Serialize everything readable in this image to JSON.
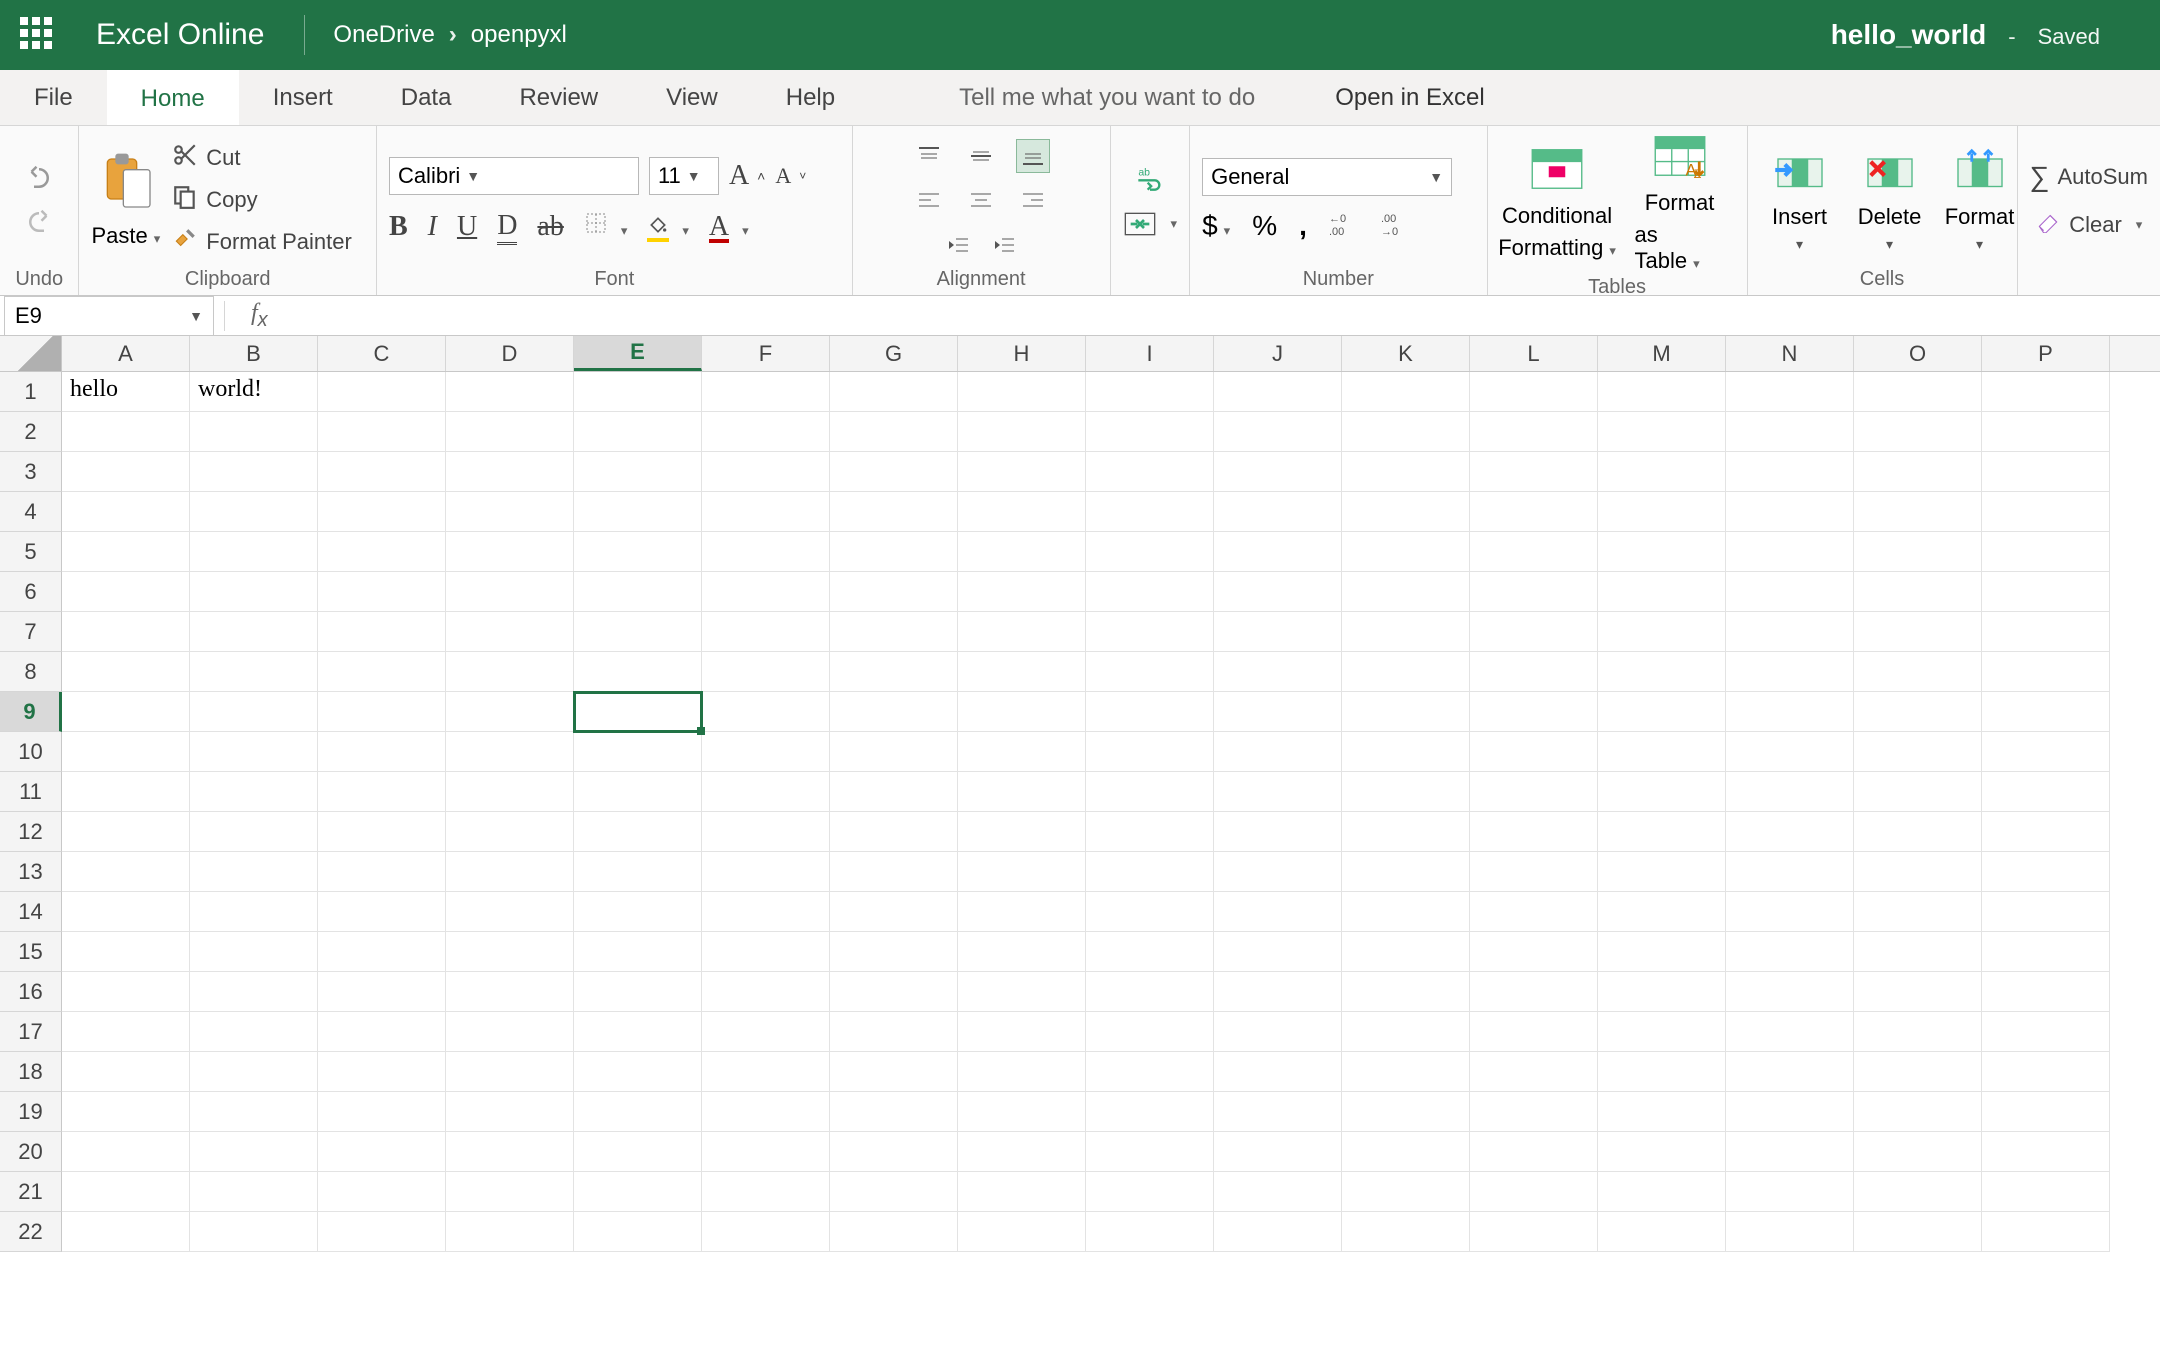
{
  "header": {
    "app_name": "Excel Online",
    "breadcrumb": [
      "OneDrive",
      "openpyxl"
    ],
    "doc_title": "hello_world",
    "status": "Saved"
  },
  "tabs": {
    "items": [
      "File",
      "Home",
      "Insert",
      "Data",
      "Review",
      "View",
      "Help"
    ],
    "active": "Home",
    "tell_me": "Tell me what you want to do",
    "open_in_excel": "Open in Excel"
  },
  "ribbon": {
    "undo_group_label": "Undo",
    "clipboard": {
      "paste": "Paste",
      "cut": "Cut",
      "copy": "Copy",
      "format_painter": "Format Painter",
      "label": "Clipboard"
    },
    "font": {
      "name": "Calibri",
      "size": "11",
      "grow": "A",
      "shrink": "A",
      "label": "Font"
    },
    "alignment": {
      "label": "Alignment"
    },
    "number": {
      "format": "General",
      "label": "Number"
    },
    "tables": {
      "conditional_formatting_l1": "Conditional",
      "conditional_formatting_l2": "Formatting",
      "format_as_table_l1": "Format",
      "format_as_table_l2": "as Table",
      "label": "Tables"
    },
    "cells": {
      "insert": "Insert",
      "delete": "Delete",
      "format": "Format",
      "label": "Cells"
    },
    "editing": {
      "autosum": "AutoSum",
      "clear": "Clear"
    }
  },
  "formula_bar": {
    "name_box": "E9",
    "formula": ""
  },
  "grid": {
    "columns": [
      "A",
      "B",
      "C",
      "D",
      "E",
      "F",
      "G",
      "H",
      "I",
      "J",
      "K",
      "L",
      "M",
      "N",
      "O",
      "P"
    ],
    "active_col_index": 4,
    "row_count": 22,
    "active_row": 9,
    "cells": {
      "A1": "hello",
      "B1": "world!"
    },
    "selected": "E9"
  }
}
